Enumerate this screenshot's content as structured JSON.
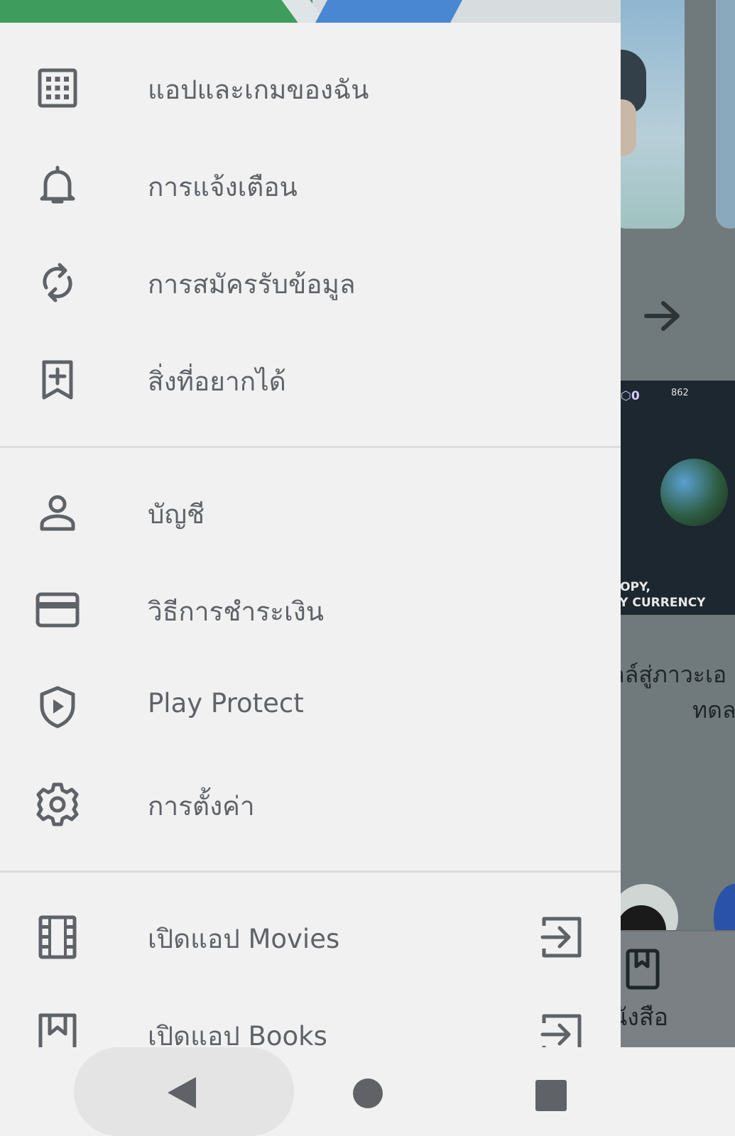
{
  "background_app": {
    "game_gems": "0",
    "game_score": "862",
    "game_caption_line1": "ROPY,",
    "game_caption_line2": "RY CURRENCY",
    "title_line1": "ลล์สู่ภาวะเอ",
    "title_line2": "ทดล",
    "bottom_nav_label": "นังสือ"
  },
  "drawer": {
    "section1": [
      {
        "label": "แอปและเกมของฉัน",
        "icon": "apps-grid-icon"
      },
      {
        "label": "การแจ้งเตือน",
        "icon": "bell-icon"
      },
      {
        "label": "การสมัครรับข้อมูล",
        "icon": "sync-icon"
      },
      {
        "label": "สิ่งที่อยากได้",
        "icon": "bookmark-add-icon"
      }
    ],
    "section2": [
      {
        "label": "บัญชี",
        "icon": "person-icon"
      },
      {
        "label": "วิธีการชำระเงิน",
        "icon": "credit-card-icon"
      },
      {
        "label": "Play Protect",
        "icon": "shield-play-icon"
      },
      {
        "label": "การตั้งค่า",
        "icon": "gear-icon"
      }
    ],
    "section3": [
      {
        "label": "เปิดแอป Movies",
        "icon": "film-icon",
        "trail_icon": "open-app-icon"
      },
      {
        "label": "เปิดแอป Books",
        "icon": "book-icon",
        "trail_icon": "open-app-icon"
      }
    ]
  },
  "colors": {
    "drawer_bg": "#f1f1f1",
    "icon_text": "#5f6368",
    "scrim": "#70797b",
    "brand_green": "#3e9c5c",
    "brand_blue": "#4a87d3"
  },
  "system_nav": {
    "back": "back-icon",
    "home": "home-icon",
    "recents": "recents-icon"
  }
}
